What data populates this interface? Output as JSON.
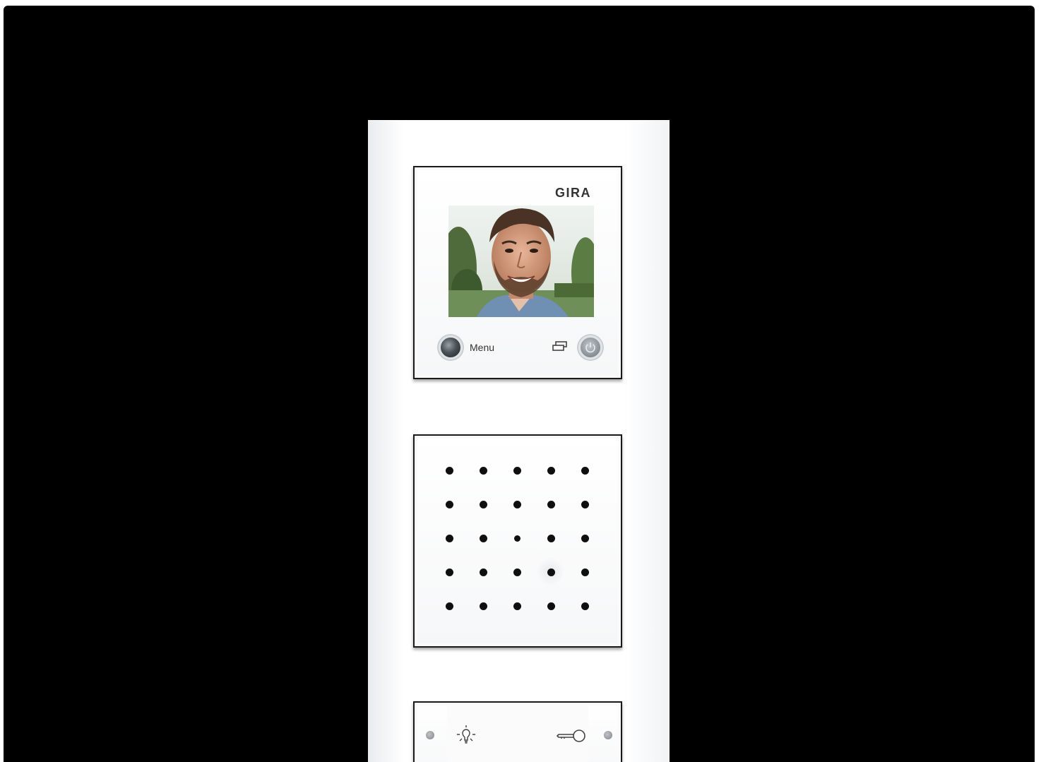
{
  "device": {
    "brand_label": "GIRA",
    "menu_label": "Menu"
  },
  "icons": {
    "menu_button": "round-button-icon",
    "switch_icon": "video-switch-icon",
    "power_button": "power-icon",
    "light_icon": "light-bulb-icon",
    "key_icon": "key-icon"
  },
  "colors": {
    "background": "#000000",
    "frame": "#ffffff",
    "module_border": "#1a1a1a",
    "speaker_dots": "#0f0f0f"
  }
}
